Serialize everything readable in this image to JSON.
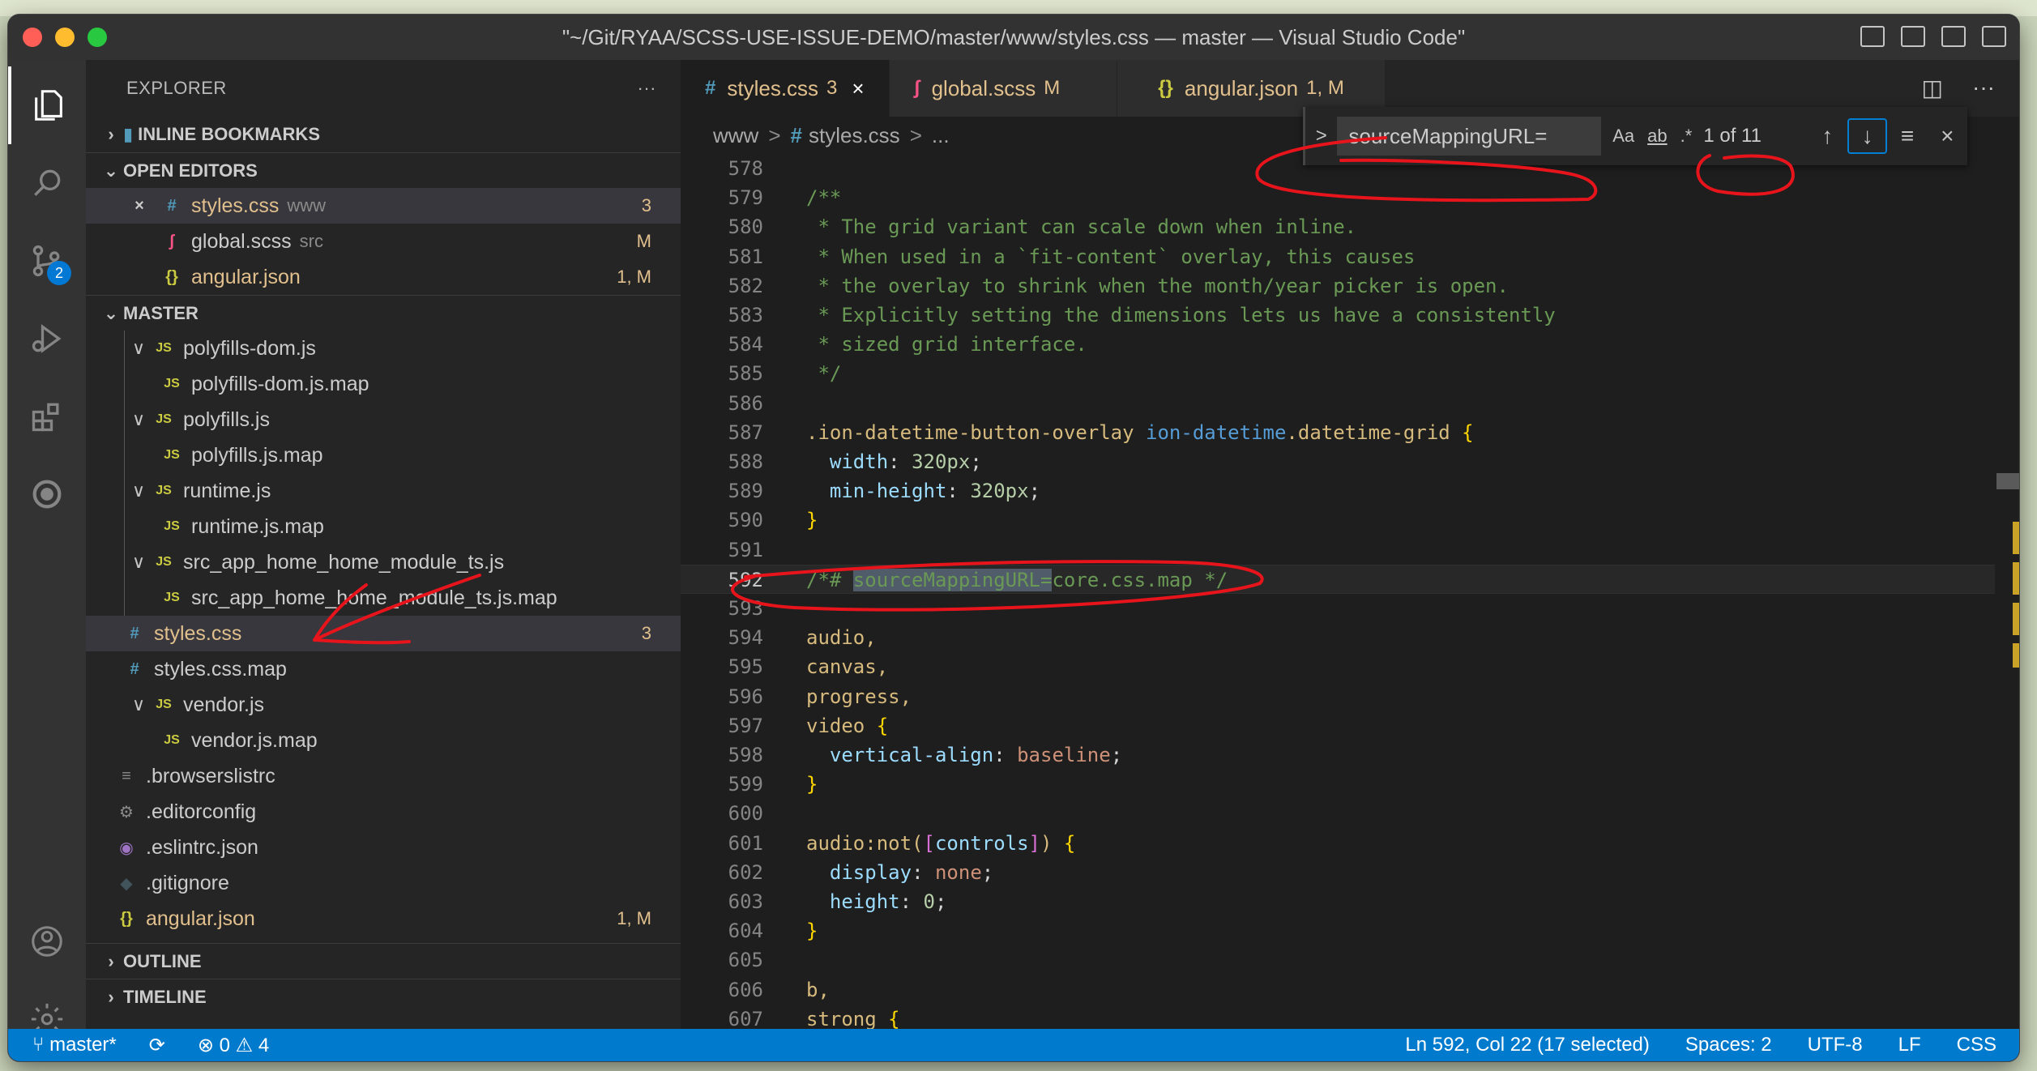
{
  "window": {
    "title": "\"~/Git/RYAA/SCSS-USE-ISSUE-DEMO/master/www/styles.css — master — Visual Studio Code\""
  },
  "activity_bar": {
    "items": [
      {
        "name": "explorer-icon",
        "glyph": "❐",
        "active": true
      },
      {
        "name": "search-icon",
        "glyph": "⌕"
      },
      {
        "name": "source-control-icon",
        "glyph": "⑂",
        "badge": "2"
      },
      {
        "name": "run-debug-icon",
        "glyph": "▷"
      },
      {
        "name": "extensions-icon",
        "glyph": "⊞"
      },
      {
        "name": "remote-icon",
        "glyph": "◎"
      },
      {
        "name": "account-icon",
        "glyph": "◯"
      },
      {
        "name": "settings-gear-icon",
        "glyph": "⚙"
      }
    ]
  },
  "sidebar": {
    "header": "EXPLORER",
    "more": "···",
    "sections": {
      "inline_bookmarks": "INLINE BOOKMARKS",
      "open_editors": "OPEN EDITORS",
      "master": "MASTER",
      "outline": "OUTLINE",
      "timeline": "TIMELINE"
    },
    "open_editors": [
      {
        "name": "styles.css",
        "meta": "www",
        "status": "3",
        "icon": "#",
        "close": "×"
      },
      {
        "name": "global.scss",
        "meta": "src",
        "status": "M",
        "icon": "ʃ"
      },
      {
        "name": "angular.json",
        "meta": "",
        "status": "1, M",
        "icon": "{}"
      }
    ],
    "master_items": [
      {
        "name": "polyfills-dom.js",
        "icon": "JS",
        "chev": "∨",
        "indent": 1
      },
      {
        "name": "polyfills-dom.js.map",
        "icon": "JS",
        "indent": 2
      },
      {
        "name": "polyfills.js",
        "icon": "JS",
        "chev": "∨",
        "indent": 1
      },
      {
        "name": "polyfills.js.map",
        "icon": "JS",
        "indent": 2
      },
      {
        "name": "runtime.js",
        "icon": "JS",
        "chev": "∨",
        "indent": 1
      },
      {
        "name": "runtime.js.map",
        "icon": "JS",
        "indent": 2
      },
      {
        "name": "src_app_home_home_module_ts.js",
        "icon": "JS",
        "chev": "∨",
        "indent": 1
      },
      {
        "name": "src_app_home_home_module_ts.js.map",
        "icon": "JS",
        "indent": 2
      },
      {
        "name": "styles.css",
        "icon": "#",
        "indent": 0,
        "status": "3",
        "selected": true
      },
      {
        "name": "styles.css.map",
        "icon": "#",
        "indent": 0
      },
      {
        "name": "vendor.js",
        "icon": "JS",
        "chev": "∨",
        "indent": 1
      },
      {
        "name": "vendor.js.map",
        "icon": "JS",
        "indent": 2
      },
      {
        "name": ".browserslistrc",
        "icon": "≡",
        "indent": -1
      },
      {
        "name": ".editorconfig",
        "icon": "⚙",
        "indent": -1
      },
      {
        "name": ".eslintrc.json",
        "icon": "◉",
        "indent": -1
      },
      {
        "name": ".gitignore",
        "icon": "◆",
        "indent": -1
      },
      {
        "name": "angular.json",
        "icon": "{}",
        "indent": -1,
        "status": "1, M"
      }
    ]
  },
  "tabs": [
    {
      "icon": "#",
      "label": "styles.css",
      "status": "3",
      "close": "×",
      "active": true
    },
    {
      "icon": "ʃ",
      "label": "global.scss",
      "status": "M"
    },
    {
      "icon": "{}",
      "label": "angular.json",
      "status": "1, M"
    }
  ],
  "breadcrumb": {
    "folder": "www",
    "icon": "#",
    "file": "styles.css",
    "sep": ">",
    "more": "..."
  },
  "find_widget": {
    "toggle": ">",
    "value": "sourceMappingURL=",
    "opt_case": "Aa",
    "opt_word": "ab",
    "opt_regex": ".*",
    "count": "1 of 11",
    "prev": "↑",
    "next": "↓",
    "selection": "≡",
    "close": "×"
  },
  "code_lines": [
    {
      "n": "578",
      "t": ""
    },
    {
      "n": "579",
      "t": "/**"
    },
    {
      "n": "580",
      "t": " * The grid variant can scale down when inline."
    },
    {
      "n": "581",
      "t": " * When used in a `fit-content` overlay, this causes"
    },
    {
      "n": "582",
      "t": " * the overlay to shrink when the month/year picker is open."
    },
    {
      "n": "583",
      "t": " * Explicitly setting the dimensions lets us have a consistently"
    },
    {
      "n": "584",
      "t": " * sized grid interface."
    },
    {
      "n": "585",
      "t": " */"
    },
    {
      "n": "586",
      "t": ""
    },
    {
      "n": "587",
      "t": ".ion-datetime-button-overlay ion-datetime.datetime-grid {"
    },
    {
      "n": "588",
      "t": "  width: 320px;"
    },
    {
      "n": "589",
      "t": "  min-height: 320px;"
    },
    {
      "n": "590",
      "t": "}"
    },
    {
      "n": "591",
      "t": ""
    },
    {
      "n": "592",
      "t": "/*# sourceMappingURL=core.css.map */"
    },
    {
      "n": "593",
      "t": ""
    },
    {
      "n": "594",
      "t": "audio,"
    },
    {
      "n": "595",
      "t": "canvas,"
    },
    {
      "n": "596",
      "t": "progress,"
    },
    {
      "n": "597",
      "t": "video {"
    },
    {
      "n": "598",
      "t": "  vertical-align: baseline;"
    },
    {
      "n": "599",
      "t": "}"
    },
    {
      "n": "600",
      "t": ""
    },
    {
      "n": "601",
      "t": "audio:not([controls]) {"
    },
    {
      "n": "602",
      "t": "  display: none;"
    },
    {
      "n": "603",
      "t": "  height: 0;"
    },
    {
      "n": "604",
      "t": "}"
    },
    {
      "n": "605",
      "t": ""
    },
    {
      "n": "606",
      "t": "b,"
    },
    {
      "n": "607",
      "t": "strong {"
    }
  ],
  "statusbar": {
    "branch": "master*",
    "sync": "⟳",
    "errors": "⊗ 0",
    "warnings": "⚠ 4",
    "position": "Ln 592, Col 22 (17 selected)",
    "spaces": "Spaces: 2",
    "encoding": "UTF-8",
    "eol": "LF",
    "language": "CSS"
  },
  "colors": {
    "accent": "#007acc",
    "annotation": "#e8141c"
  }
}
